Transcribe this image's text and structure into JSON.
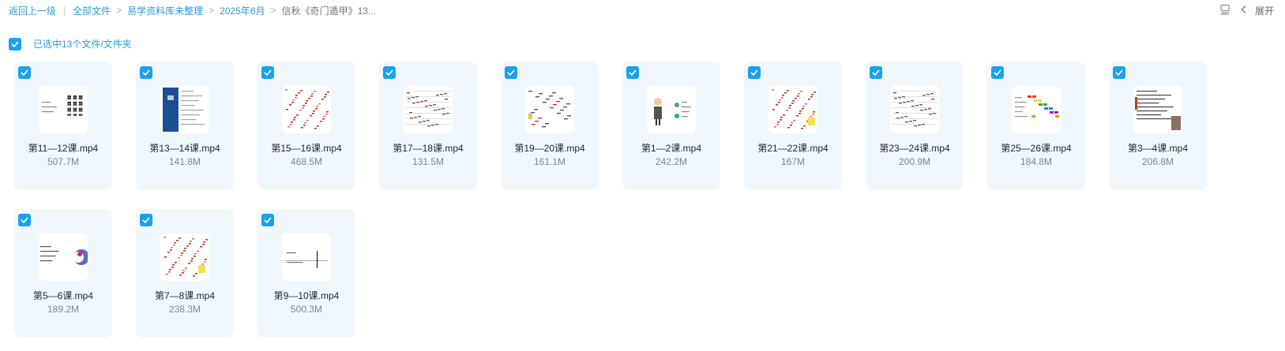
{
  "breadcrumb": {
    "back": "返回上一级",
    "items": [
      "全部文件",
      "易学资料库未整理",
      "2025年6月"
    ],
    "current": "信秋《奇门遁甲》13..."
  },
  "toolbar": {
    "collapse_label": "展开",
    "list_icon": "list-view-icon",
    "chevron_icon": "chevron-left-icon"
  },
  "selection": {
    "label": "已选中13个文件/文件夹",
    "checked": true
  },
  "colors": {
    "accent": "#1ba0ee",
    "link": "#2e9bdb",
    "card_bg": "#f1f8fd"
  },
  "files": [
    {
      "name": "第11—12课.mp4",
      "size": "507.7M",
      "thumb": "qr"
    },
    {
      "name": "第13—14课.mp4",
      "size": "141.8M",
      "thumb": "blue"
    },
    {
      "name": "第15—16课.mp4",
      "size": "468.5M",
      "thumb": "red"
    },
    {
      "name": "第17—18课.mp4",
      "size": "131.5M",
      "thumb": "table"
    },
    {
      "name": "第19—20课.mp4",
      "size": "161.1M",
      "thumb": "mixed"
    },
    {
      "name": "第1—2课.mp4",
      "size": "242.2M",
      "thumb": "person"
    },
    {
      "name": "第21—22课.mp4",
      "size": "167M",
      "thumb": "redyellow"
    },
    {
      "name": "第23—24课.mp4",
      "size": "200.9M",
      "thumb": "table"
    },
    {
      "name": "第25—26课.mp4",
      "size": "184.8M",
      "thumb": "color"
    },
    {
      "name": "第3—4课.mp4",
      "size": "206.8M",
      "thumb": "doc"
    },
    {
      "name": "第5—6课.mp4",
      "size": "189.2M",
      "thumb": "circle"
    },
    {
      "name": "第7—8课.mp4",
      "size": "238.3M",
      "thumb": "redyellow2"
    },
    {
      "name": "第9—10课.mp4",
      "size": "500.3M",
      "thumb": "line"
    }
  ]
}
